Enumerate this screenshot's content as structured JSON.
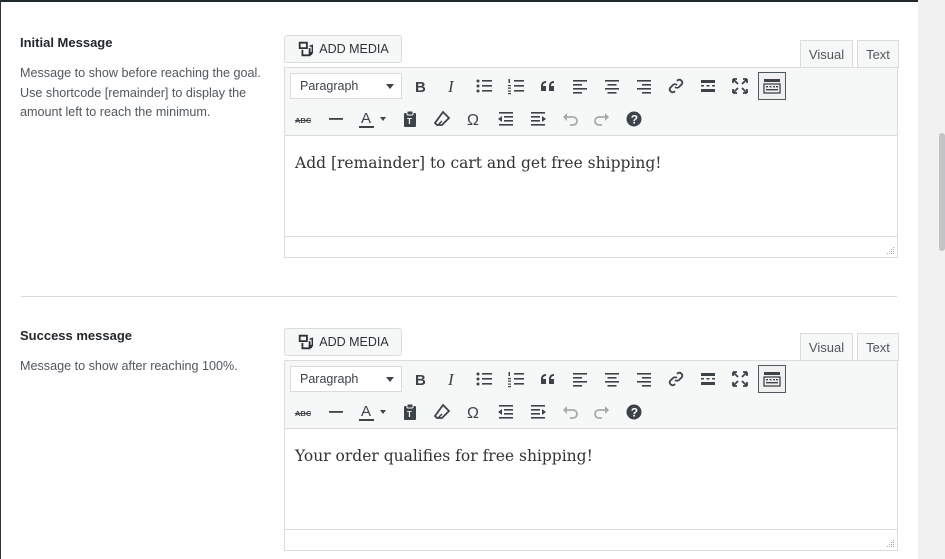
{
  "fields": [
    {
      "title": "Initial Message",
      "description": "Message to show before reaching the goal. Use shortcode [remainder] to display the amount left to reach the minimum.",
      "add_media": "ADD MEDIA",
      "tabs": [
        "Visual",
        "Text"
      ],
      "active_tab": "Visual",
      "format_value": "Paragraph",
      "content": "Add [remainder] to cart and get free shipping!"
    },
    {
      "title": "Success message",
      "description": "Message to show after reaching 100%.",
      "add_media": "ADD MEDIA",
      "tabs": [
        "Visual",
        "Text"
      ],
      "active_tab": "Visual",
      "format_value": "Paragraph",
      "content": "Your order qualifies for free shipping!"
    }
  ],
  "toolbar_icons": {
    "row1": [
      "bold-icon",
      "italic-icon",
      "bullet-list-icon",
      "numbered-list-icon",
      "blockquote-icon",
      "align-left-icon",
      "align-center-icon",
      "align-right-icon",
      "link-icon",
      "read-more-icon",
      "fullscreen-icon",
      "toolbar-toggle-icon"
    ],
    "row2": [
      "strikethrough-icon",
      "horizontal-line-icon",
      "text-color-icon",
      "paste-text-icon",
      "clear-formatting-icon",
      "special-character-icon",
      "outdent-icon",
      "indent-icon",
      "undo-icon",
      "redo-icon",
      "help-icon"
    ]
  }
}
